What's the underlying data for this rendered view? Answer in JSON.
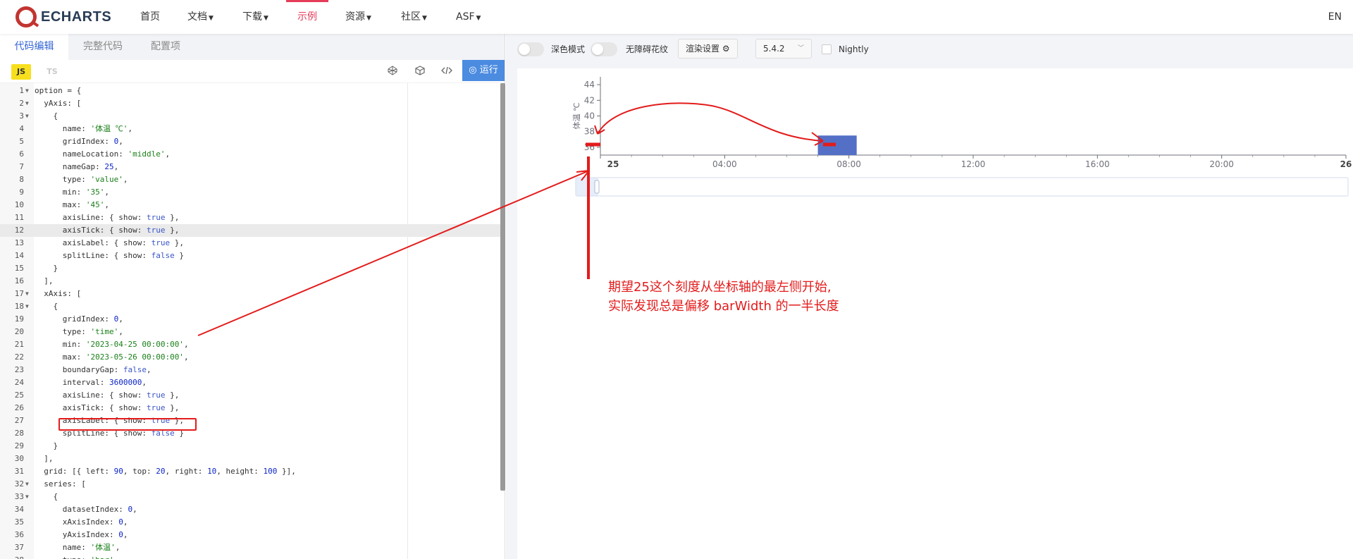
{
  "nav": {
    "logo_text": "ECHARTS",
    "items": [
      {
        "label": "首页",
        "has_caret": false
      },
      {
        "label": "文档",
        "has_caret": true
      },
      {
        "label": "下载",
        "has_caret": true
      },
      {
        "label": "示例",
        "has_caret": false,
        "active": true
      },
      {
        "label": "资源",
        "has_caret": true
      },
      {
        "label": "社区",
        "has_caret": true
      },
      {
        "label": "ASF",
        "has_caret": true
      }
    ],
    "lang": "EN"
  },
  "left_tabs": [
    "代码编辑",
    "完整代码",
    "配置项"
  ],
  "editor_toolbar": {
    "js": "JS",
    "ts": "TS",
    "run": "运行"
  },
  "code_lines": [
    "option = {",
    "  yAxis: [",
    "    {",
    "      name: '体温 ℃',",
    "      gridIndex: 0,",
    "      nameLocation: 'middle',",
    "      nameGap: 25,",
    "      type: 'value',",
    "      min: '35',",
    "      max: '45',",
    "      axisLine: { show: true },",
    "      axisTick: { show: true },",
    "      axisLabel: { show: true },",
    "      splitLine: { show: false }",
    "    }",
    "  ],",
    "  xAxis: [",
    "    {",
    "      gridIndex: 0,",
    "      type: 'time',",
    "      min: '2023-04-25 00:00:00',",
    "      max: '2023-05-26 00:00:00',",
    "      boundaryGap: false,",
    "      interval: 3600000,",
    "      axisLine: { show: true },",
    "      axisTick: { show: true },",
    "      axisLabel: { show: true },",
    "      splitLine: { show: false }",
    "    }",
    "  ],",
    "  grid: [{ left: 90, top: 20, right: 10, height: 100 }],",
    "  series: [",
    "    {",
    "      datasetIndex: 0,",
    "      xAxisIndex: 0,",
    "      yAxisIndex: 0,",
    "      name: '体温',",
    "      type: 'bar',"
  ],
  "fold_lines": [
    1,
    2,
    3,
    17,
    18,
    32,
    33
  ],
  "highlight_line": 12,
  "right_toolbar": {
    "dark_mode": "深色模式",
    "a11y": "无障碍花纹",
    "render_settings": "渲染设置",
    "version": "5.4.2",
    "nightly": "Nightly"
  },
  "chart_data": {
    "type": "bar",
    "yaxis": {
      "name": "体温 ℃",
      "min": 35,
      "max": 45,
      "ticks": [
        36,
        38,
        40,
        42,
        44
      ]
    },
    "xaxis": {
      "type": "time",
      "tick_labels": [
        "25",
        "04:00",
        "08:00",
        "12:00",
        "16:00",
        "20:00",
        "26"
      ]
    },
    "series": [
      {
        "x": "07:00-08:15",
        "value": 37.5
      }
    ]
  },
  "annotation": {
    "line1": "期望25这个刻度从坐标轴的最左侧开始,",
    "line2": "实际发现总是偏移 barWidth 的一半长度"
  },
  "colors": {
    "accent": "#e43c59",
    "bar": "#5470c6",
    "annotation": "#e31b1b",
    "run": "#4b8be0"
  }
}
